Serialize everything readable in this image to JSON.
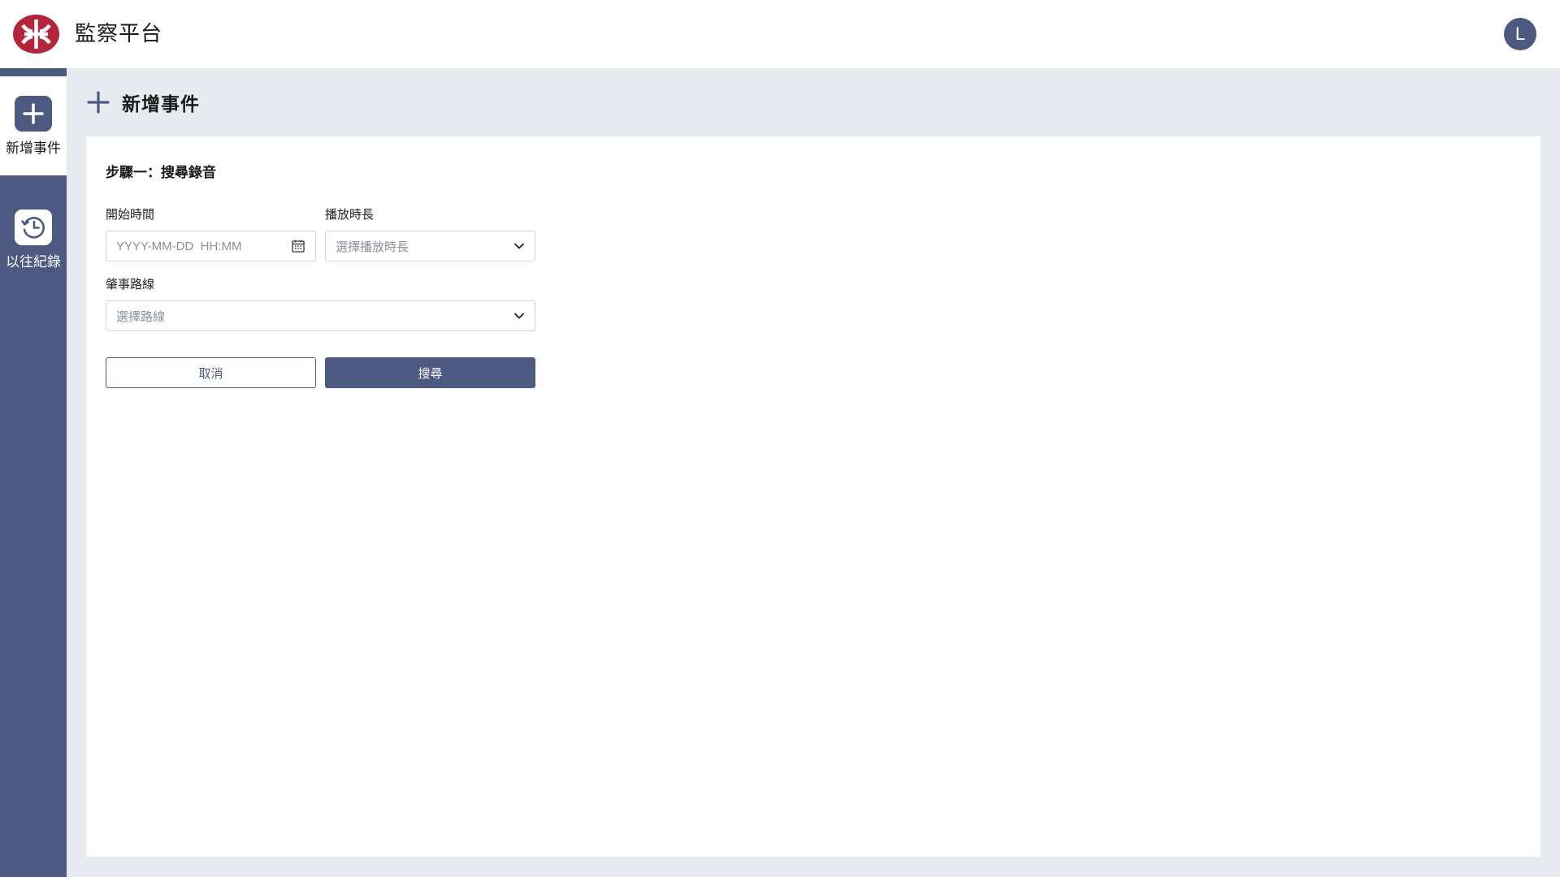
{
  "app": {
    "title": "監察平台",
    "logo_icon": "mtr-logo-icon",
    "brand_color": "#b5243a",
    "accent_color": "#4c5a82"
  },
  "user": {
    "avatar_initial": "L"
  },
  "sidebar": {
    "items": [
      {
        "label": "新增事件",
        "icon": "plus-icon",
        "active": true
      },
      {
        "label": "以往紀錄",
        "icon": "history-icon",
        "active": false
      }
    ]
  },
  "page": {
    "title": "新增事件",
    "icon": "plus-icon"
  },
  "form": {
    "step_title": "步驟一：搜尋錄音",
    "start_time": {
      "label": "開始時間",
      "placeholder": "YYYY-MM-DD  HH:MM",
      "icon": "calendar-icon"
    },
    "duration": {
      "label": "播放時長",
      "placeholder": "選擇播放時長",
      "icon": "chevron-down-icon"
    },
    "route": {
      "label": "肇事路線",
      "placeholder": "選擇路線",
      "icon": "chevron-down-icon"
    },
    "cancel_label": "取消",
    "search_label": "搜尋"
  }
}
